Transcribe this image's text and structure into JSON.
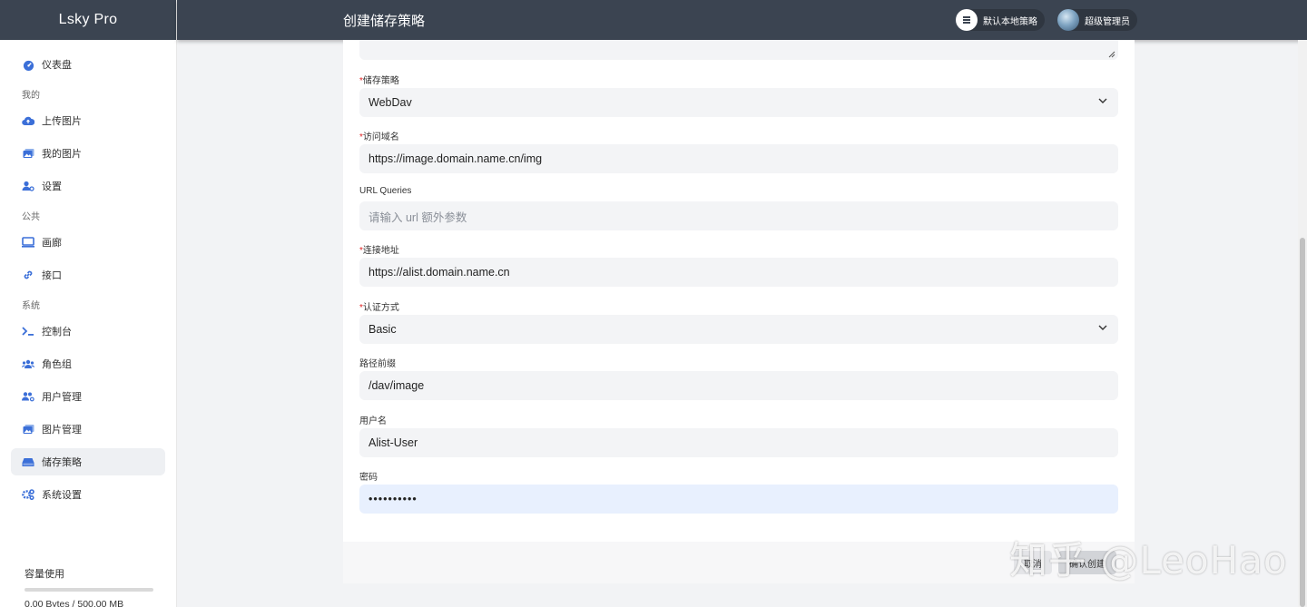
{
  "app": {
    "brand": "Lsky Pro"
  },
  "header": {
    "title": "创建储存策略",
    "strategy_label": "默认本地策略",
    "user_label": "超级管理员"
  },
  "sidebar": {
    "dashboard": "仪表盘",
    "section_mine": "我的",
    "upload": "上传图片",
    "my_images": "我的图片",
    "settings": "设置",
    "section_public": "公共",
    "gallery": "画廊",
    "api": "接口",
    "section_system": "系统",
    "console": "控制台",
    "roles": "角色组",
    "users": "用户管理",
    "images": "图片管理",
    "strategies": "储存策略",
    "system_settings": "系统设置",
    "usage_title": "容量使用",
    "usage_text": "0.00 Bytes / 500.00 MB",
    "usage_fraction": 0
  },
  "form": {
    "driver": {
      "label": "储存策略",
      "value": "WebDav"
    },
    "domain": {
      "label": "访问域名",
      "value": "https://image.domain.name.cn/img"
    },
    "queries": {
      "label": "URL Queries",
      "placeholder": "请输入 url 额外参数"
    },
    "endpoint": {
      "label": "连接地址",
      "value": "https://alist.domain.name.cn"
    },
    "auth": {
      "label": "认证方式",
      "value": "Basic"
    },
    "prefix": {
      "label": "路径前缀",
      "value": "/dav/image"
    },
    "username": {
      "label": "用户名",
      "value": "Alist-User"
    },
    "password": {
      "label": "密码",
      "value": "••••••••••"
    },
    "cancel_label": "取消",
    "confirm_label": "确认创建"
  },
  "watermark": "知乎 @LeoHao",
  "colors": {
    "header_bg": "#3b4451",
    "required": "#e02424",
    "icon_blue": "#3b6fd8"
  }
}
